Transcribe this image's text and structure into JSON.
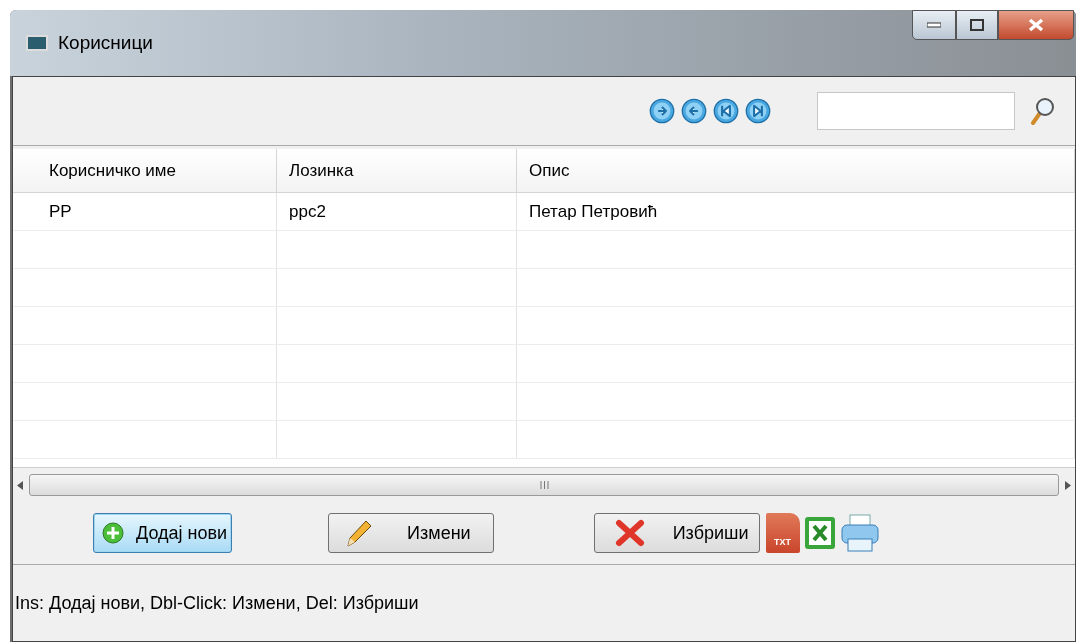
{
  "window": {
    "title": "Корисници"
  },
  "navigation": [
    {
      "kind": "next"
    },
    {
      "kind": "previous"
    },
    {
      "kind": "first"
    },
    {
      "kind": "last"
    }
  ],
  "table": {
    "columns": [
      "Корисничко име",
      "Лозинка",
      "Опис"
    ],
    "rows": [
      [
        "PP",
        "ppc2",
        "Петар Петровић"
      ]
    ]
  },
  "buttons": [
    {
      "label": "Додај нови",
      "kind": "add",
      "focused": true
    },
    {
      "label": "Измени",
      "kind": "edit",
      "focused": false
    },
    {
      "label": "Избриши",
      "kind": "delete",
      "focused": false
    }
  ],
  "export_icons": [
    {
      "kind": "txt",
      "label": "TXT"
    },
    {
      "kind": "excel"
    },
    {
      "kind": "print"
    }
  ],
  "status_bar": "Ins: Додај нови, Dbl-Click: Измени, Del: Избриши"
}
